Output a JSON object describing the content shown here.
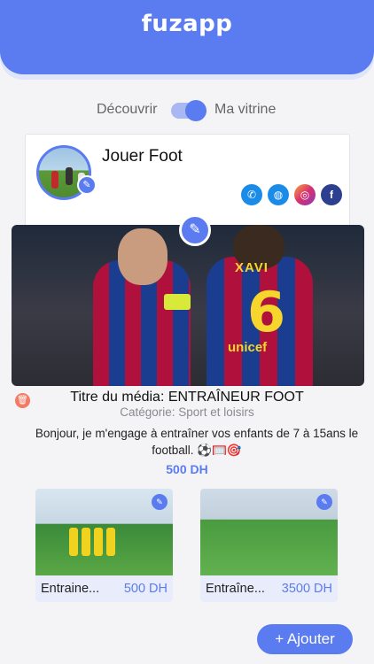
{
  "app": {
    "title": "fuzapp"
  },
  "toggle": {
    "left_label": "Découvrir",
    "right_label": "Ma vitrine",
    "state": "on"
  },
  "profile": {
    "name": "Jouer Foot",
    "socials": [
      {
        "icon": "phone-icon",
        "color": "#1b8be8"
      },
      {
        "icon": "globe-icon",
        "color": "#1b8be8"
      },
      {
        "icon": "instagram-icon",
        "color": "#d6306f"
      },
      {
        "icon": "facebook-icon",
        "color": "#2d3f8f"
      }
    ]
  },
  "media": {
    "title": "Titre du média: ENTRAÎNEUR FOOT",
    "category": "Catégorie: Sport et loisirs",
    "description": "Bonjour, je m'engage à entraîner vos enfants de 7 à 15ans le football. ⚽🥅🎯",
    "price": "500 DH",
    "jersey_name": "XAVI",
    "jersey_number": "6",
    "sponsor": "unicef"
  },
  "products": [
    {
      "name": "Entraine...",
      "price": "500 DH"
    },
    {
      "name": "Entraîne...",
      "price": "3500 DH"
    }
  ],
  "actions": {
    "add_label": "+ Ajouter"
  },
  "colors": {
    "accent": "#5b7cf0",
    "delete": "#f37a63",
    "background": "#f4f4f6"
  }
}
